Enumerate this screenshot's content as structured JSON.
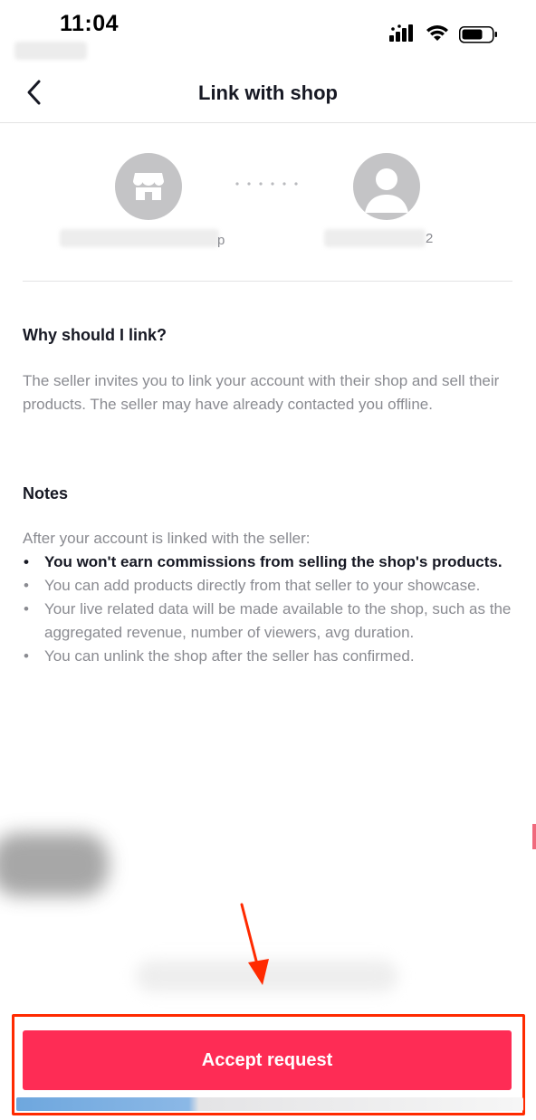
{
  "status_bar": {
    "time": "11:04",
    "icons": [
      "cellular-signal-icon",
      "wifi-icon",
      "battery-icon"
    ]
  },
  "nav": {
    "title": "Link with shop",
    "back_icon": "chevron-left-icon"
  },
  "link": {
    "shop_avatar_icon": "storefront-icon",
    "user_avatar_icon": "person-icon",
    "shop_name_visible": "p",
    "user_name_visible": "2"
  },
  "why": {
    "heading": "Why should I link?",
    "body": "The seller invites you to link your account with their shop and sell their products. The seller may have already contacted you offline."
  },
  "notes": {
    "heading": "Notes",
    "intro": "After your account is linked with the seller:",
    "bullet_char": "•",
    "items": [
      "You won't earn commissions from selling the shop's products.",
      "You can add products directly from that seller to your showcase.",
      "Your live related data will be made available to the shop, such as the aggregated revenue, number of viewers, avg duration.",
      "You can unlink the shop after the seller has confirmed."
    ]
  },
  "action": {
    "accept_label": "Accept request"
  },
  "colors": {
    "primary": "#fe2c55",
    "annotation": "#ff2a00",
    "text_primary": "#161823",
    "text_secondary": "#8a8b91",
    "avatar_bg": "#c4c4c6"
  }
}
